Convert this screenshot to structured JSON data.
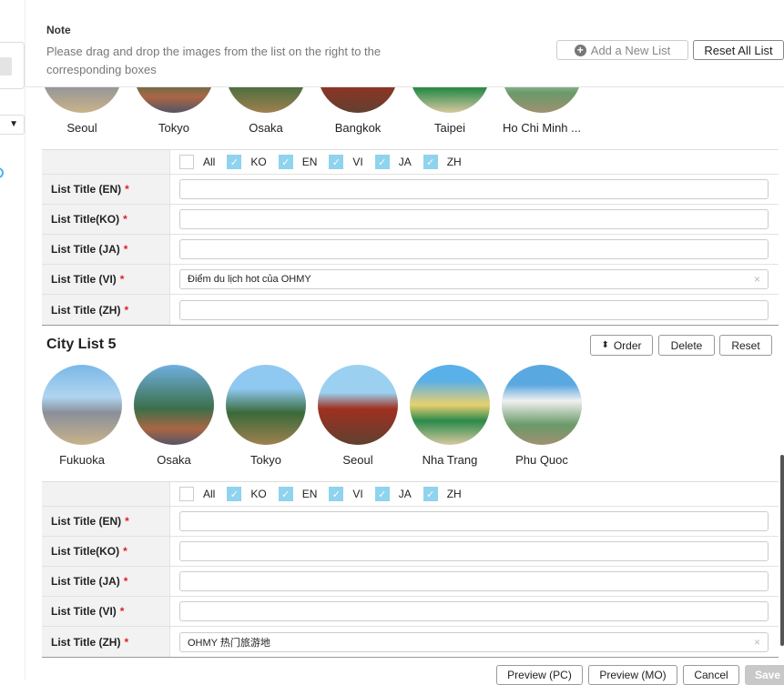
{
  "note": {
    "title": "Note",
    "text": "Please drag and drop the images from the list on the right to the corresponding boxes"
  },
  "actions": {
    "add_list": "Add a New List",
    "reset_all": "Reset All List"
  },
  "top_list": {
    "cities": [
      "Seoul",
      "Tokyo",
      "Osaka",
      "Bangkok",
      "Taipei",
      "Ho Chi Minh ..."
    ]
  },
  "languages": [
    {
      "label": "All",
      "checked": false
    },
    {
      "label": "KO",
      "checked": true
    },
    {
      "label": "EN",
      "checked": true
    },
    {
      "label": "VI",
      "checked": true
    },
    {
      "label": "JA",
      "checked": true
    },
    {
      "label": "ZH",
      "checked": true
    }
  ],
  "form1": {
    "rows": [
      {
        "label": "List Title (EN)",
        "value": ""
      },
      {
        "label": "List Title(KO)",
        "value": ""
      },
      {
        "label": "List Title (JA)",
        "value": ""
      },
      {
        "label": "List Title (VI)",
        "value": "Điểm du lịch hot của OHMY"
      },
      {
        "label": "List Title (ZH)",
        "value": ""
      }
    ]
  },
  "list5": {
    "title": "City List 5",
    "order": "Order",
    "delete": "Delete",
    "reset": "Reset",
    "cities": [
      "Fukuoka",
      "Osaka",
      "Tokyo",
      "Seoul",
      "Nha Trang",
      "Phu Quoc"
    ]
  },
  "form2": {
    "rows": [
      {
        "label": "List Title (EN)",
        "value": ""
      },
      {
        "label": "List Title(KO)",
        "value": ""
      },
      {
        "label": "List Title (JA)",
        "value": ""
      },
      {
        "label": "List Title (VI)",
        "value": ""
      },
      {
        "label": "List Title (ZH)",
        "value": "OHMY 热门旅游地"
      }
    ]
  },
  "footer": {
    "preview_pc": "Preview (PC)",
    "preview_mo": "Preview (MO)",
    "cancel": "Cancel",
    "save": "Save"
  },
  "required_mark": "*",
  "dropdown_arrow": "▼",
  "clear_icon": "×",
  "order_icon": "⬍"
}
